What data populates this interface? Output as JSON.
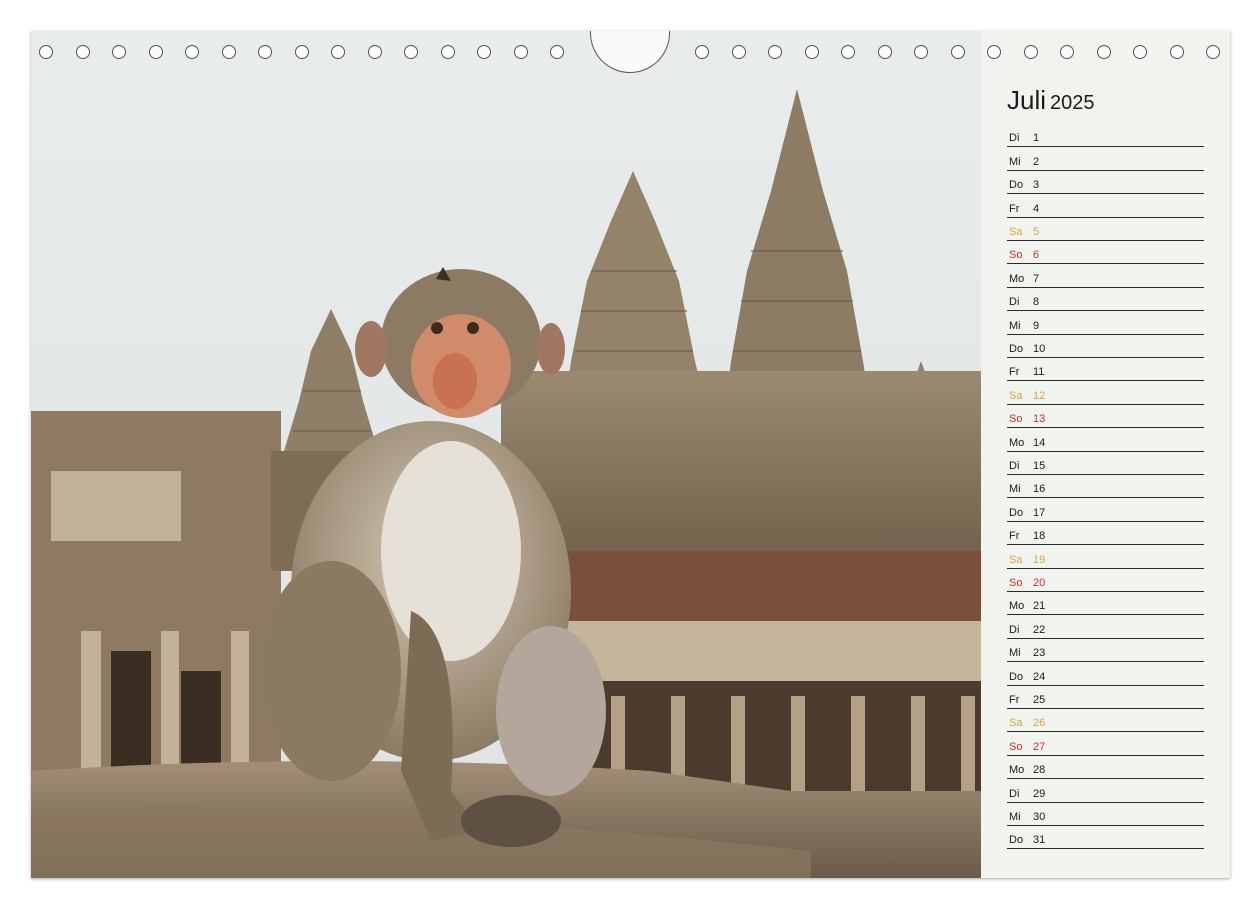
{
  "calendar": {
    "month": "Juli",
    "year": "2025",
    "days": [
      {
        "wd": "Di",
        "num": "1",
        "type": "weekday"
      },
      {
        "wd": "Mi",
        "num": "2",
        "type": "weekday"
      },
      {
        "wd": "Do",
        "num": "3",
        "type": "weekday"
      },
      {
        "wd": "Fr",
        "num": "4",
        "type": "weekday"
      },
      {
        "wd": "Sa",
        "num": "5",
        "type": "sat"
      },
      {
        "wd": "So",
        "num": "6",
        "type": "sun"
      },
      {
        "wd": "Mo",
        "num": "7",
        "type": "weekday"
      },
      {
        "wd": "Di",
        "num": "8",
        "type": "weekday"
      },
      {
        "wd": "Mi",
        "num": "9",
        "type": "weekday"
      },
      {
        "wd": "Do",
        "num": "10",
        "type": "weekday"
      },
      {
        "wd": "Fr",
        "num": "11",
        "type": "weekday"
      },
      {
        "wd": "Sa",
        "num": "12",
        "type": "sat"
      },
      {
        "wd": "So",
        "num": "13",
        "type": "sun"
      },
      {
        "wd": "Mo",
        "num": "14",
        "type": "weekday"
      },
      {
        "wd": "Di",
        "num": "15",
        "type": "weekday"
      },
      {
        "wd": "Mi",
        "num": "16",
        "type": "weekday"
      },
      {
        "wd": "Do",
        "num": "17",
        "type": "weekday"
      },
      {
        "wd": "Fr",
        "num": "18",
        "type": "weekday"
      },
      {
        "wd": "Sa",
        "num": "19",
        "type": "sat"
      },
      {
        "wd": "So",
        "num": "20",
        "type": "sun"
      },
      {
        "wd": "Mo",
        "num": "21",
        "type": "weekday"
      },
      {
        "wd": "Di",
        "num": "22",
        "type": "weekday"
      },
      {
        "wd": "Mi",
        "num": "23",
        "type": "weekday"
      },
      {
        "wd": "Do",
        "num": "24",
        "type": "weekday"
      },
      {
        "wd": "Fr",
        "num": "25",
        "type": "weekday"
      },
      {
        "wd": "Sa",
        "num": "26",
        "type": "sat"
      },
      {
        "wd": "So",
        "num": "27",
        "type": "sun"
      },
      {
        "wd": "Mo",
        "num": "28",
        "type": "weekday"
      },
      {
        "wd": "Di",
        "num": "29",
        "type": "weekday"
      },
      {
        "wd": "Mi",
        "num": "30",
        "type": "weekday"
      },
      {
        "wd": "Do",
        "num": "31",
        "type": "weekday"
      }
    ]
  },
  "colors": {
    "saturday": "#d9a23a",
    "sunday": "#c8302c",
    "panel": "#f1f4ee"
  },
  "photo": {
    "subject": "macaque-icon"
  }
}
